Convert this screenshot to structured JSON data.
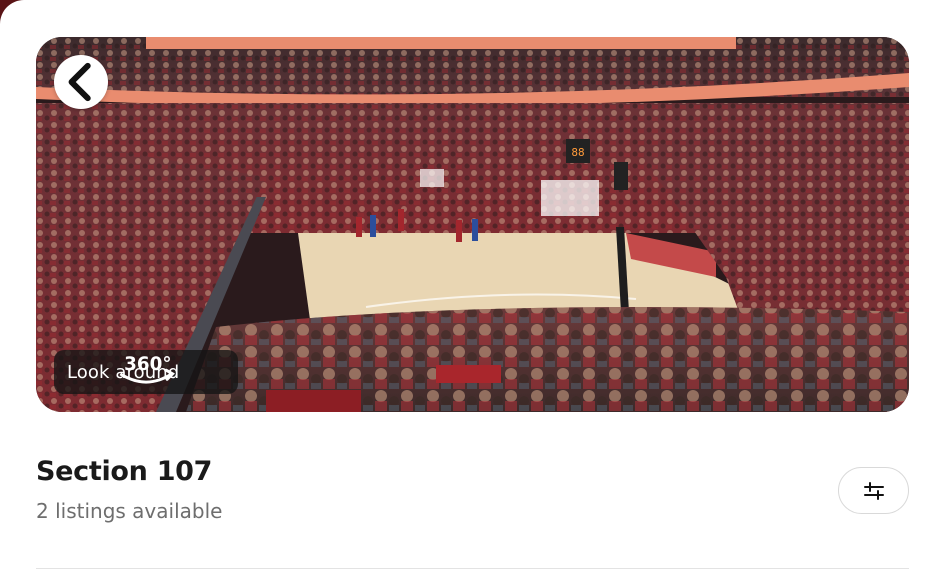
{
  "hero": {
    "image_alt": "View from section",
    "back_icon": "chevron-left-icon",
    "look_around_label": "Look around",
    "look_around_icon": "360-icon",
    "icon_360_text": "360°",
    "scoreboard_text": "88"
  },
  "section": {
    "title": "Section 107",
    "listings_text": "2 listings available"
  },
  "filter": {
    "icon": "sliders-icon"
  },
  "colors": {
    "page_edge": "#5a1416",
    "court": "#e9d6b3",
    "banner": "#e98c6f"
  }
}
